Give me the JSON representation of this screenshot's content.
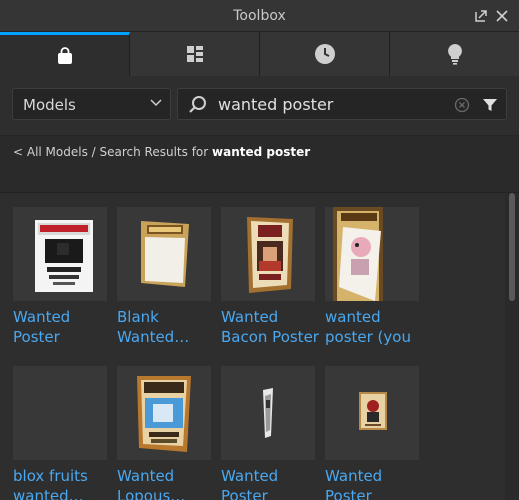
{
  "window": {
    "title": "Toolbox"
  },
  "tabs": [
    {
      "name": "marketplace",
      "icon": "bag-icon",
      "active": true
    },
    {
      "name": "inventory",
      "icon": "grid-icon",
      "active": false
    },
    {
      "name": "recent",
      "icon": "clock-icon",
      "active": false
    },
    {
      "name": "creations",
      "icon": "lightbulb-icon",
      "active": false
    }
  ],
  "filter": {
    "category": "Models",
    "search_value": "wanted poster"
  },
  "breadcrumb": {
    "prefix": "< All Models / Search Results for ",
    "query": "wanted poster"
  },
  "results": [
    {
      "line1": "Wanted",
      "line2": "Poster"
    },
    {
      "line1": "Blank",
      "line2": "Wanted…"
    },
    {
      "line1": "Wanted",
      "line2": "Bacon Poster"
    },
    {
      "line1": "wanted",
      "line2": "poster (you"
    },
    {
      "line1": "blox fruits",
      "line2": "wanted…"
    },
    {
      "line1": "Wanted",
      "line2": "Lopous…"
    },
    {
      "line1": "Wanted",
      "line2": "Poster"
    },
    {
      "line1": "Wanted",
      "line2": "Poster"
    }
  ],
  "colors": {
    "accent": "#00a2ff",
    "link": "#4aa8f0",
    "background": "#2e2e2e"
  }
}
